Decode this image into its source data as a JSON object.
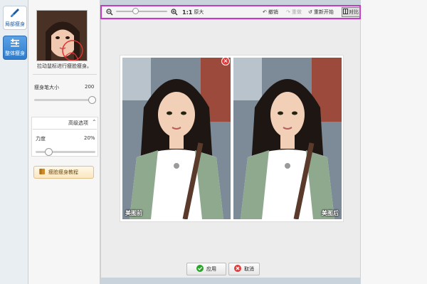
{
  "rail": {
    "items": [
      {
        "label": "局部瘦身",
        "icon": "brush-icon"
      },
      {
        "label": "整体瘦身",
        "icon": "sliders-icon"
      }
    ]
  },
  "panel": {
    "hint": "拉动鼠标进行瘦脸瘦身。",
    "brush_label": "瘦身笔大小",
    "brush_value": "200",
    "brush_level": 1.0,
    "advanced_title": "高级选项",
    "strength_label": "力度",
    "strength_value": "20%",
    "strength_level": 0.2,
    "tutorial_label": "瘦脸瘦身教程"
  },
  "toolbar": {
    "zoom_level": 0.45,
    "original_size": "原大",
    "ratio": "1:1",
    "undo": "撤销",
    "redo": "重做",
    "restart": "重新开始",
    "compare": "对比"
  },
  "preview": {
    "before_label": "美图前",
    "after_label": "美图后"
  },
  "actions": {
    "apply": "应用",
    "cancel": "取消"
  },
  "colors": {
    "toolbar_highlight": "#c23cc4",
    "rail_active": "#2f7ccc",
    "apply_check": "#2aa52a",
    "cancel_x": "#e43a3a"
  }
}
